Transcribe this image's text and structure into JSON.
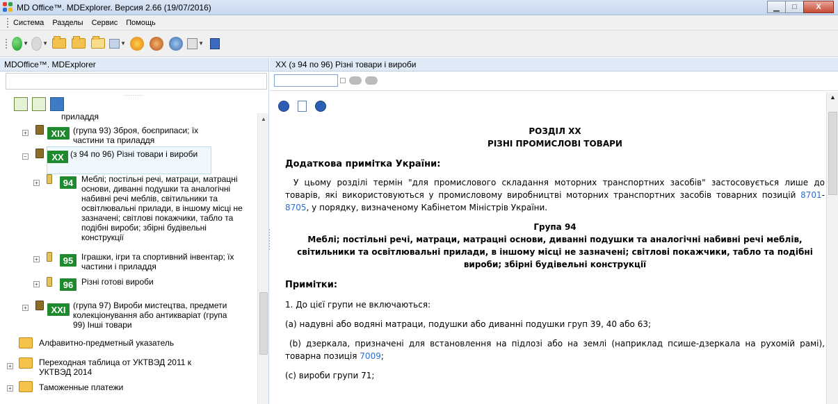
{
  "window": {
    "title": "MD Office™. MDExplorer. Версия 2.66 (19/07/2016)",
    "buttons": {
      "minimize": "▁",
      "maximize": "□",
      "close": "X"
    }
  },
  "menu": [
    "Система",
    "Разделы",
    "Сервис",
    "Помощь"
  ],
  "left_panel": {
    "title": "MDOffice™. MDExplorer",
    "tree": {
      "top_cut": "приладдя",
      "xix_badge": "XIX",
      "xix_label": "(група 93) Зброя, боєприпаси; їх частини та приладдя",
      "xx_badge": "XX",
      "xx_label": "(з 94 по 96) Різні товари і вироби",
      "g94_badge": "94",
      "g94_label": "Меблі; постільні речі, матраци, матрацні основи, диванні подушки та аналогічні набивні речі меблів, світильники та освітлювальні прилади, в іншому місці не зазначені; світлові покажчики, табло та подібні вироби; збірні будівельні конструкції",
      "g95_badge": "95",
      "g95_label": "Іграшки, ігри та спортивний інвентар; їх частини і приладдя",
      "g96_badge": "96",
      "g96_label": "Різні готові вироби",
      "xxi_badge": "XXI",
      "xxi_label": "(група 97) Вироби мистецтва, предмети колекціонування або антикваріат (група 99) Інші товари",
      "alpha_index": "Алфавитно-предметный указатель",
      "transition_table": "Переходная таблица от УКТВЭД 2011 к УКТВЭД 2014",
      "customs": "Таможенные платежи"
    }
  },
  "right_panel": {
    "title": "XX (з 94 по 96) Різні товари і вироби",
    "doc": {
      "section": "РОЗДІЛ XX",
      "section_name": "РІЗНІ ПРОМИСЛОВІ ТОВАРИ",
      "note_head": "Додаткова примітка України:",
      "note_text_a": "У цьому розділі термін \"для промислового складання моторних транспортних засобів\" застосовується лише до товарів, які використовуються у промисловому виробництві моторних транспортних засобів товарних позицій ",
      "link1": "8701",
      "dash": "-",
      "link2": "8705",
      "note_text_b": ", у порядку, визначеному Кабінетом Міністрів України.",
      "group": "Група 94",
      "group_title": "Меблі; постільні речі, матраци, матрацні основи, диванні подушки та аналогічні набивні речі меблів, світильники та освітлювальні прилади, в іншому місці не зазначені; світлові покажчики, табло та подібні вироби; збірні будівельні конструкції",
      "notes_head": "Примітки:",
      "item1": "1. До цієї групи не включаються:",
      "item_a": "(a) надувні або водяні матраци, подушки або диванні подушки груп 39, 40 або 63;",
      "item_b_text": "(b) дзеркала, призначені для встановлення на підлозі або на землі (наприклад псише-дзеркала на рухомій рамі), товарна позиція ",
      "item_b_link": "7009",
      "item_b_end": ";",
      "item_c": "(c) вироби групи 71;"
    }
  }
}
